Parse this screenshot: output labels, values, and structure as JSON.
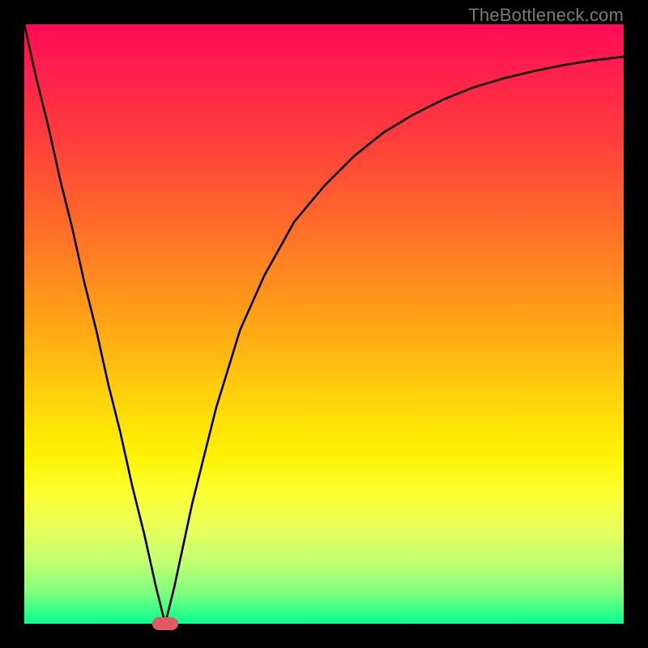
{
  "watermark": "TheBottleneck.com",
  "chart_data": {
    "type": "line",
    "title": "",
    "xlabel": "",
    "ylabel": "",
    "xlim": [
      0,
      100
    ],
    "ylim": [
      0,
      100
    ],
    "grid": false,
    "legend": false,
    "series": [
      {
        "name": "curve",
        "x": [
          0,
          2,
          4,
          6,
          8,
          10,
          12,
          14,
          16,
          18,
          20,
          22,
          23.5,
          25,
          28,
          32,
          36,
          40,
          45,
          50,
          55,
          60,
          65,
          70,
          75,
          80,
          85,
          90,
          95,
          100
        ],
        "y": [
          100,
          91,
          83,
          74,
          66,
          57,
          49,
          40,
          32,
          23,
          15,
          6,
          0,
          6,
          20,
          36,
          49,
          58,
          67,
          73,
          78,
          82,
          85,
          87.5,
          89.5,
          91,
          92.2,
          93.2,
          94,
          94.6
        ]
      }
    ],
    "marker": {
      "x": 23.5,
      "y": 0
    },
    "background_gradient": {
      "direction": "vertical",
      "stops": [
        {
          "pos": 0.0,
          "color": "#ff0b55"
        },
        {
          "pos": 0.33,
          "color": "#ff6a2a"
        },
        {
          "pos": 0.66,
          "color": "#ffe008"
        },
        {
          "pos": 0.95,
          "color": "#7cff80"
        },
        {
          "pos": 1.0,
          "color": "#06ff8e"
        }
      ]
    }
  }
}
